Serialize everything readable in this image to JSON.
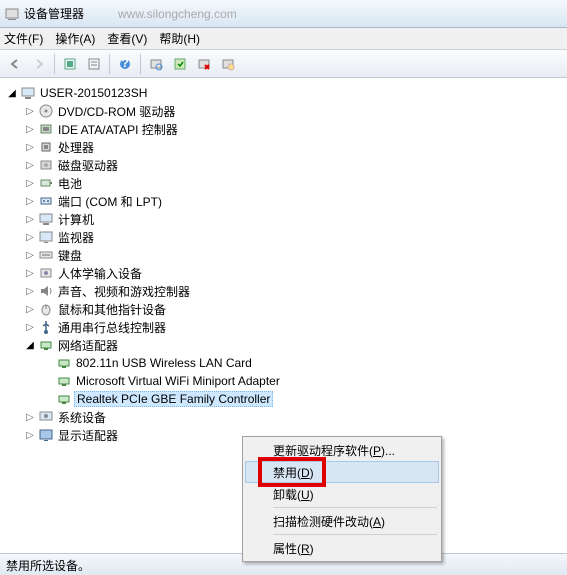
{
  "window": {
    "title": "设备管理器",
    "faded_url": "www.silongcheng.com"
  },
  "menu": {
    "file": "文件(F)",
    "action": "操作(A)",
    "view": "查看(V)",
    "help": "帮助(H)"
  },
  "tree": {
    "root": "USER-20150123SH",
    "items": [
      {
        "label": "DVD/CD-ROM 驱动器",
        "icon": "disc"
      },
      {
        "label": "IDE ATA/ATAPI 控制器",
        "icon": "chip"
      },
      {
        "label": "处理器",
        "icon": "cpu"
      },
      {
        "label": "磁盘驱动器",
        "icon": "disk"
      },
      {
        "label": "电池",
        "icon": "battery"
      },
      {
        "label": "端口 (COM 和 LPT)",
        "icon": "port"
      },
      {
        "label": "计算机",
        "icon": "computer"
      },
      {
        "label": "监视器",
        "icon": "monitor"
      },
      {
        "label": "键盘",
        "icon": "keyboard"
      },
      {
        "label": "人体学输入设备",
        "icon": "hid"
      },
      {
        "label": "声音、视频和游戏控制器",
        "icon": "sound"
      },
      {
        "label": "鼠标和其他指针设备",
        "icon": "mouse"
      },
      {
        "label": "通用串行总线控制器",
        "icon": "usb"
      },
      {
        "label": "网络适配器",
        "icon": "network",
        "open": true,
        "children": [
          {
            "label": "802.11n USB Wireless LAN Card",
            "icon": "netcard"
          },
          {
            "label": "Microsoft Virtual WiFi Miniport Adapter",
            "icon": "netcard"
          },
          {
            "label": "Realtek PCIe GBE Family Controller",
            "icon": "netcard",
            "selected": true
          }
        ]
      },
      {
        "label": "系统设备",
        "icon": "system"
      },
      {
        "label": "显示适配器",
        "icon": "display"
      }
    ]
  },
  "context_menu": {
    "update_driver": "更新驱动程序软件(P)...",
    "disable": "禁用(D)",
    "uninstall": "卸载(U)",
    "scan": "扫描检测硬件改动(A)",
    "properties": "属性(R)"
  },
  "status": "禁用所选设备。"
}
